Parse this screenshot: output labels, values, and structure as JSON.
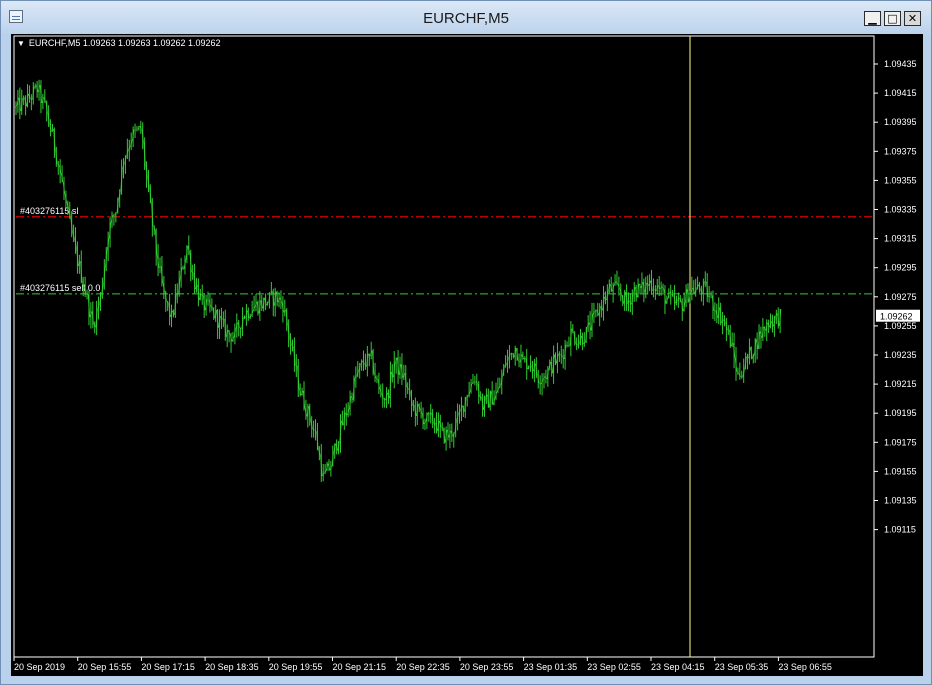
{
  "window": {
    "title": "EURCHF,M5"
  },
  "header": {
    "symbol_info": "EURCHF,M5  1.09263 1.09263 1.09262 1.09262"
  },
  "colors": {
    "candle": "#32cd32",
    "sl_line": "#ff0000",
    "order_line": "#32cd32",
    "crosshair": "#ffff7f",
    "grid": "#ffffff"
  },
  "orders": [
    {
      "label": "#403276115 sl",
      "price": 1.0933
    },
    {
      "label": "#403276115 sell 0.0",
      "price": 1.09277
    }
  ],
  "chart_data": {
    "type": "candlestick",
    "symbol": "EURCHF",
    "timeframe": "M5",
    "current_price_label": "1.09262",
    "current_price": 1.09262,
    "ylim": [
      1.09108,
      1.0945
    ],
    "y_ticks": [
      "1.09435",
      "1.09415",
      "1.09395",
      "1.09375",
      "1.09355",
      "1.09335",
      "1.09315",
      "1.09295",
      "1.09275",
      "1.09255",
      "1.09235",
      "1.09215",
      "1.09195",
      "1.09175",
      "1.09155",
      "1.09135",
      "1.09115"
    ],
    "x_ticks": [
      "20 Sep 2019",
      "20 Sep 15:55",
      "20 Sep 17:15",
      "20 Sep 18:35",
      "20 Sep 19:55",
      "20 Sep 21:15",
      "20 Sep 22:35",
      "20 Sep 23:55",
      "23 Sep 01:35",
      "23 Sep 02:55",
      "23 Sep 04:15",
      "23 Sep 05:35",
      "23 Sep 06:55"
    ],
    "close_path": [
      [
        0,
        1.09405
      ],
      [
        6,
        1.0941
      ],
      [
        11,
        1.09418
      ],
      [
        15,
        1.09405
      ],
      [
        19,
        1.09385
      ],
      [
        23,
        1.0936
      ],
      [
        27,
        1.0933
      ],
      [
        31,
        1.09305
      ],
      [
        35,
        1.09285
      ],
      [
        40,
        1.09255
      ],
      [
        44,
        1.09275
      ],
      [
        48,
        1.0932
      ],
      [
        52,
        1.09335
      ],
      [
        56,
        1.0937
      ],
      [
        60,
        1.09385
      ],
      [
        65,
        1.0939
      ],
      [
        69,
        1.09345
      ],
      [
        73,
        1.09305
      ],
      [
        77,
        1.09275
      ],
      [
        81,
        1.0926
      ],
      [
        85,
        1.09285
      ],
      [
        89,
        1.0931
      ],
      [
        93,
        1.09285
      ],
      [
        97,
        1.0927
      ],
      [
        102,
        1.09265
      ],
      [
        106,
        1.09258
      ],
      [
        110,
        1.0925
      ],
      [
        114,
        1.09248
      ],
      [
        118,
        1.09262
      ],
      [
        123,
        1.09268
      ],
      [
        127,
        1.0927
      ],
      [
        131,
        1.09272
      ],
      [
        135,
        1.09275
      ],
      [
        139,
        1.0927
      ],
      [
        144,
        1.09235
      ],
      [
        148,
        1.0921
      ],
      [
        152,
        1.09195
      ],
      [
        156,
        1.0918
      ],
      [
        160,
        1.0915
      ],
      [
        164,
        1.0916
      ],
      [
        168,
        1.0918
      ],
      [
        173,
        1.092
      ],
      [
        177,
        1.0922
      ],
      [
        181,
        1.0923
      ],
      [
        185,
        1.09232
      ],
      [
        189,
        1.0921
      ],
      [
        193,
        1.09205
      ],
      [
        197,
        1.0923
      ],
      [
        202,
        1.0922
      ],
      [
        206,
        1.092
      ],
      [
        210,
        1.09195
      ],
      [
        214,
        1.0919
      ],
      [
        218,
        1.0919
      ],
      [
        222,
        1.0918
      ],
      [
        226,
        1.0918
      ],
      [
        230,
        1.0919
      ],
      [
        235,
        1.0921
      ],
      [
        239,
        1.0922
      ],
      [
        243,
        1.092
      ],
      [
        247,
        1.09205
      ],
      [
        251,
        1.0921
      ],
      [
        255,
        1.0923
      ],
      [
        260,
        1.0924
      ],
      [
        264,
        1.0923
      ],
      [
        268,
        1.0923
      ],
      [
        272,
        1.0922
      ],
      [
        276,
        1.09222
      ],
      [
        280,
        1.0923
      ],
      [
        284,
        1.09235
      ],
      [
        289,
        1.0925
      ],
      [
        293,
        1.09245
      ],
      [
        297,
        1.0925
      ],
      [
        301,
        1.0926
      ],
      [
        305,
        1.0927
      ],
      [
        309,
        1.0928
      ],
      [
        314,
        1.0928
      ],
      [
        318,
        1.0927
      ],
      [
        322,
        1.0928
      ],
      [
        326,
        1.0928
      ],
      [
        330,
        1.09285
      ],
      [
        334,
        1.09282
      ],
      [
        338,
        1.09275
      ],
      [
        343,
        1.0927
      ],
      [
        347,
        1.0927
      ],
      [
        351,
        1.0928
      ],
      [
        355,
        1.0928
      ],
      [
        359,
        1.0928
      ],
      [
        363,
        1.0927
      ],
      [
        368,
        1.0926
      ],
      [
        372,
        1.09245
      ],
      [
        376,
        1.0922
      ],
      [
        380,
        1.0923
      ],
      [
        384,
        1.0924
      ],
      [
        388,
        1.0925
      ],
      [
        392,
        1.09258
      ],
      [
        396,
        1.0926
      ],
      [
        398,
        1.09262
      ]
    ]
  }
}
